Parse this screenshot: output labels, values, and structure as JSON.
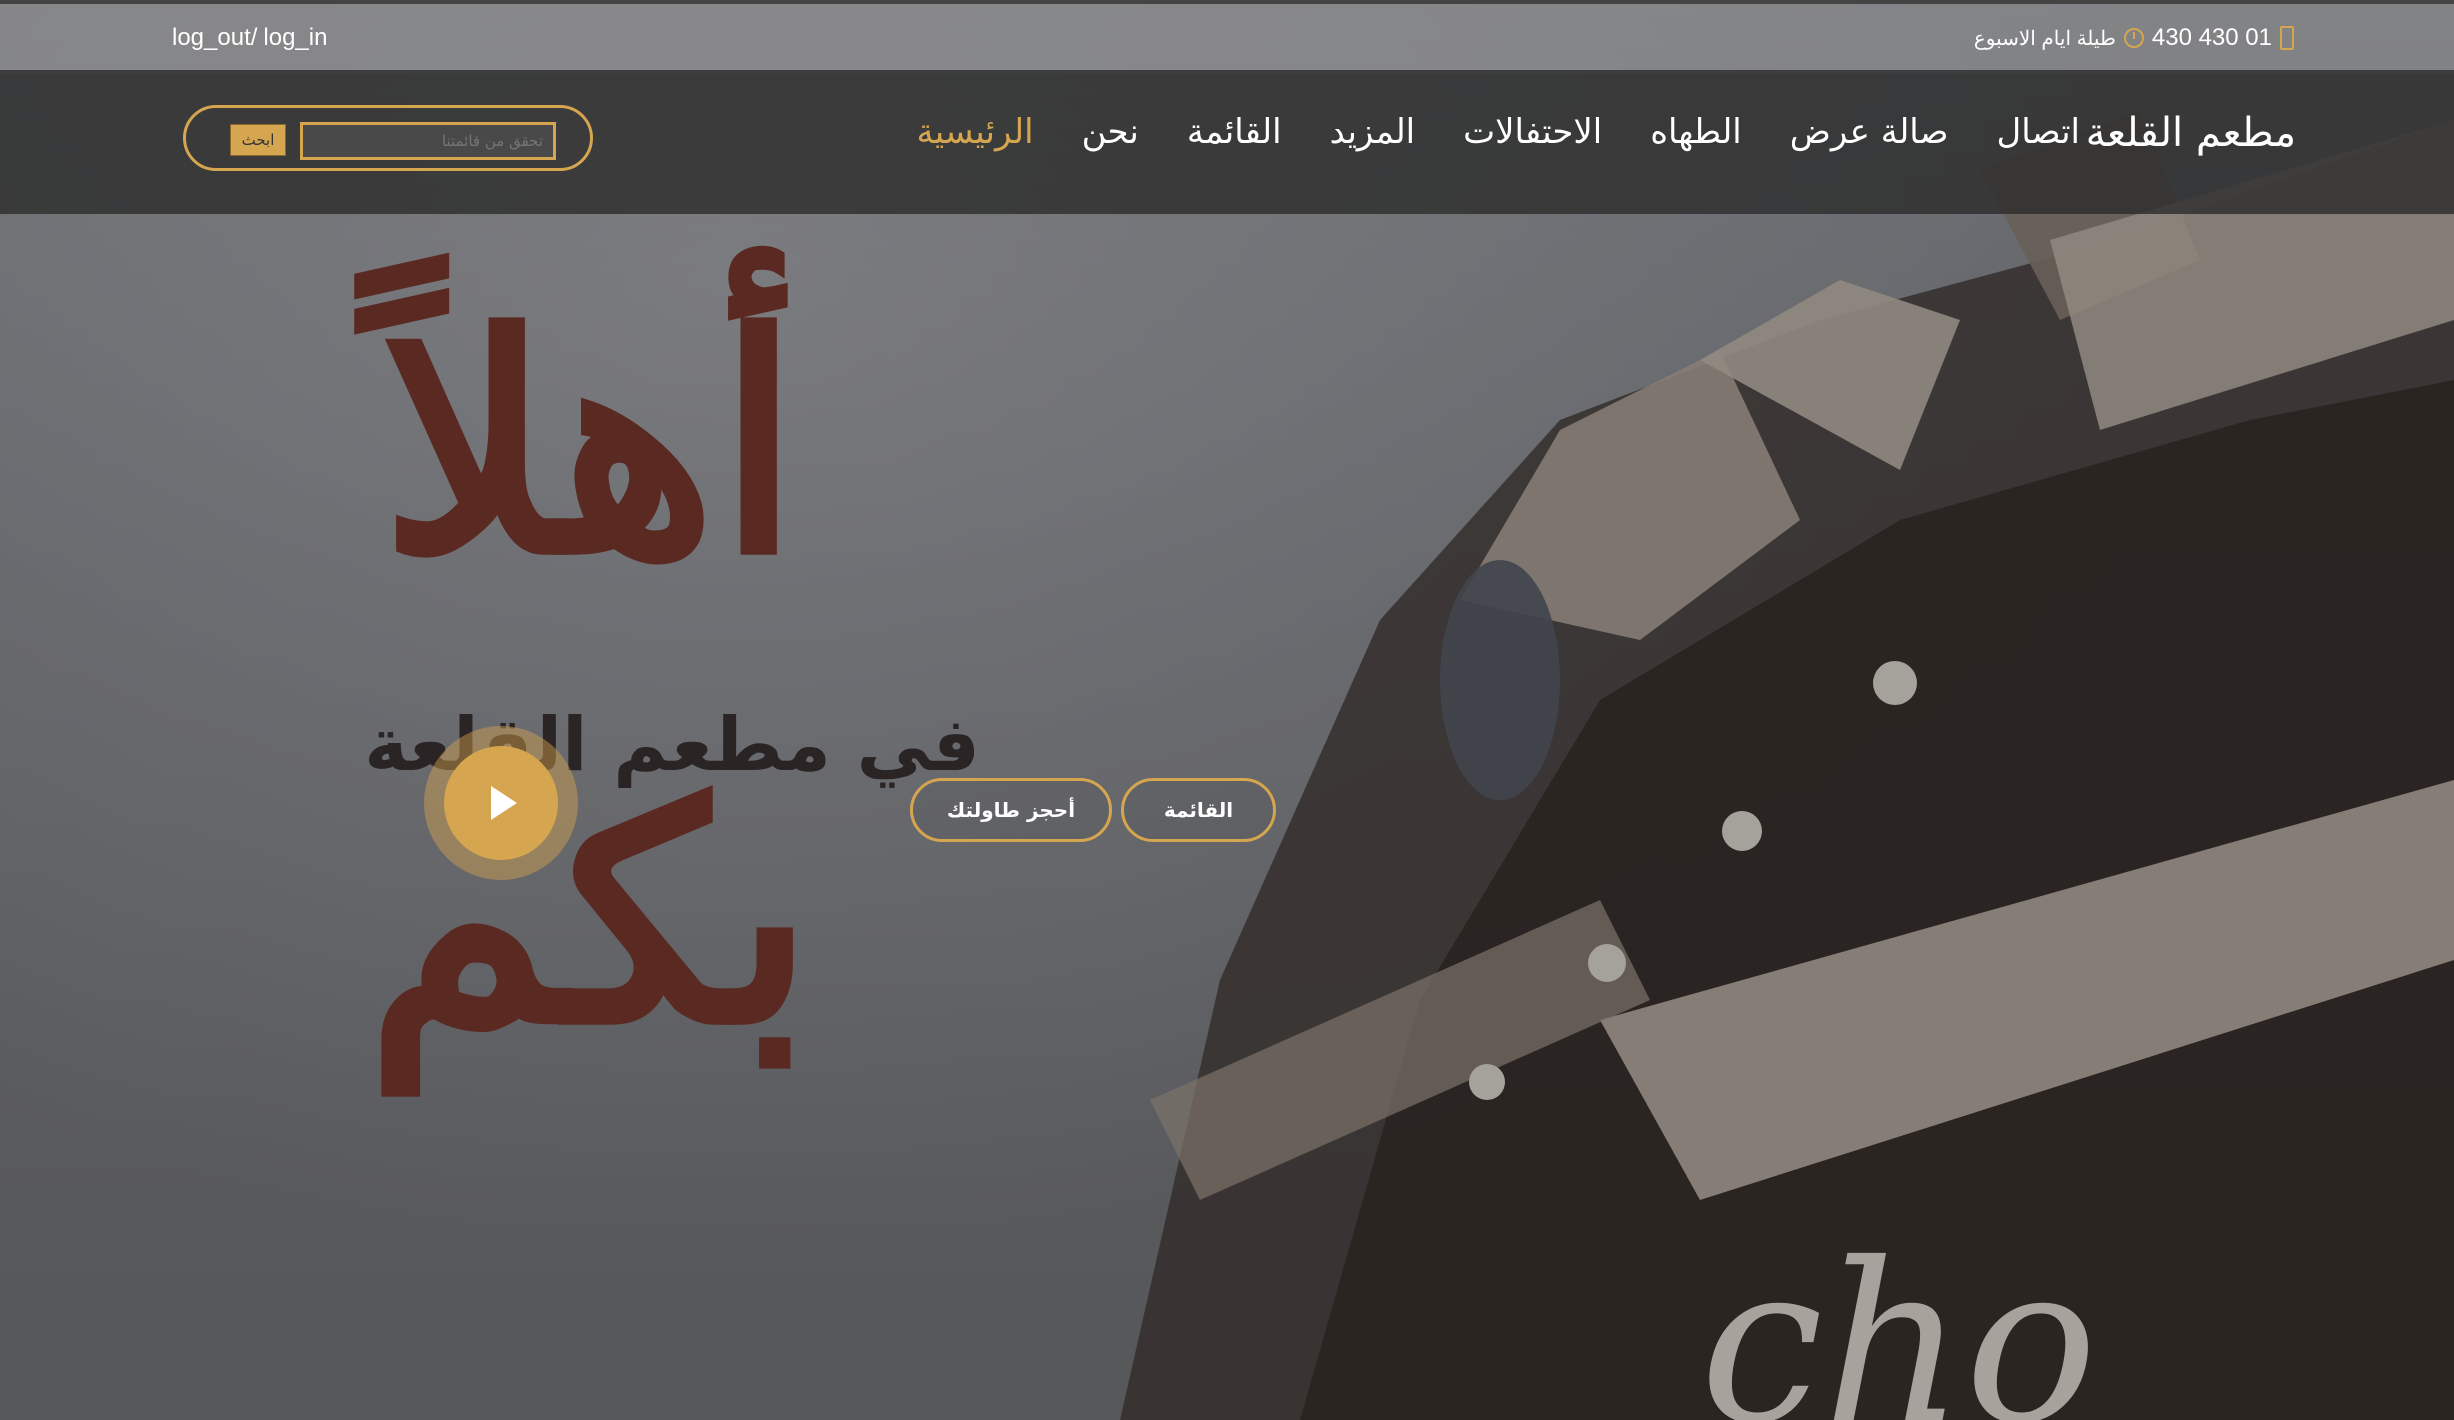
{
  "topbar": {
    "logout": "log_out/",
    "login": "log_in",
    "phone": "430 430 01",
    "hours": "طيلة ايام الاسبوع"
  },
  "navbar": {
    "brand": "مطعم القلعة",
    "items": [
      {
        "label": "الرئيسية",
        "active": true
      },
      {
        "label": "نحن"
      },
      {
        "label": "القائمة"
      },
      {
        "label": "المزيد"
      },
      {
        "label": "الاحتفالات"
      },
      {
        "label": "الطهاه"
      },
      {
        "label": "صالة عرض"
      },
      {
        "label": "اتصال"
      }
    ],
    "search": {
      "placeholder": "تحقق من قائمتنا",
      "button": "ابحث"
    }
  },
  "hero": {
    "welcome": "أهلاً بكم",
    "subtitle": "في مطعم القلعة",
    "buttons": {
      "reserve": "أحجز طاولتك",
      "menu": "القائمة"
    }
  },
  "colors": {
    "accent": "#d6a550",
    "welcome_text": "#5a2a22"
  }
}
